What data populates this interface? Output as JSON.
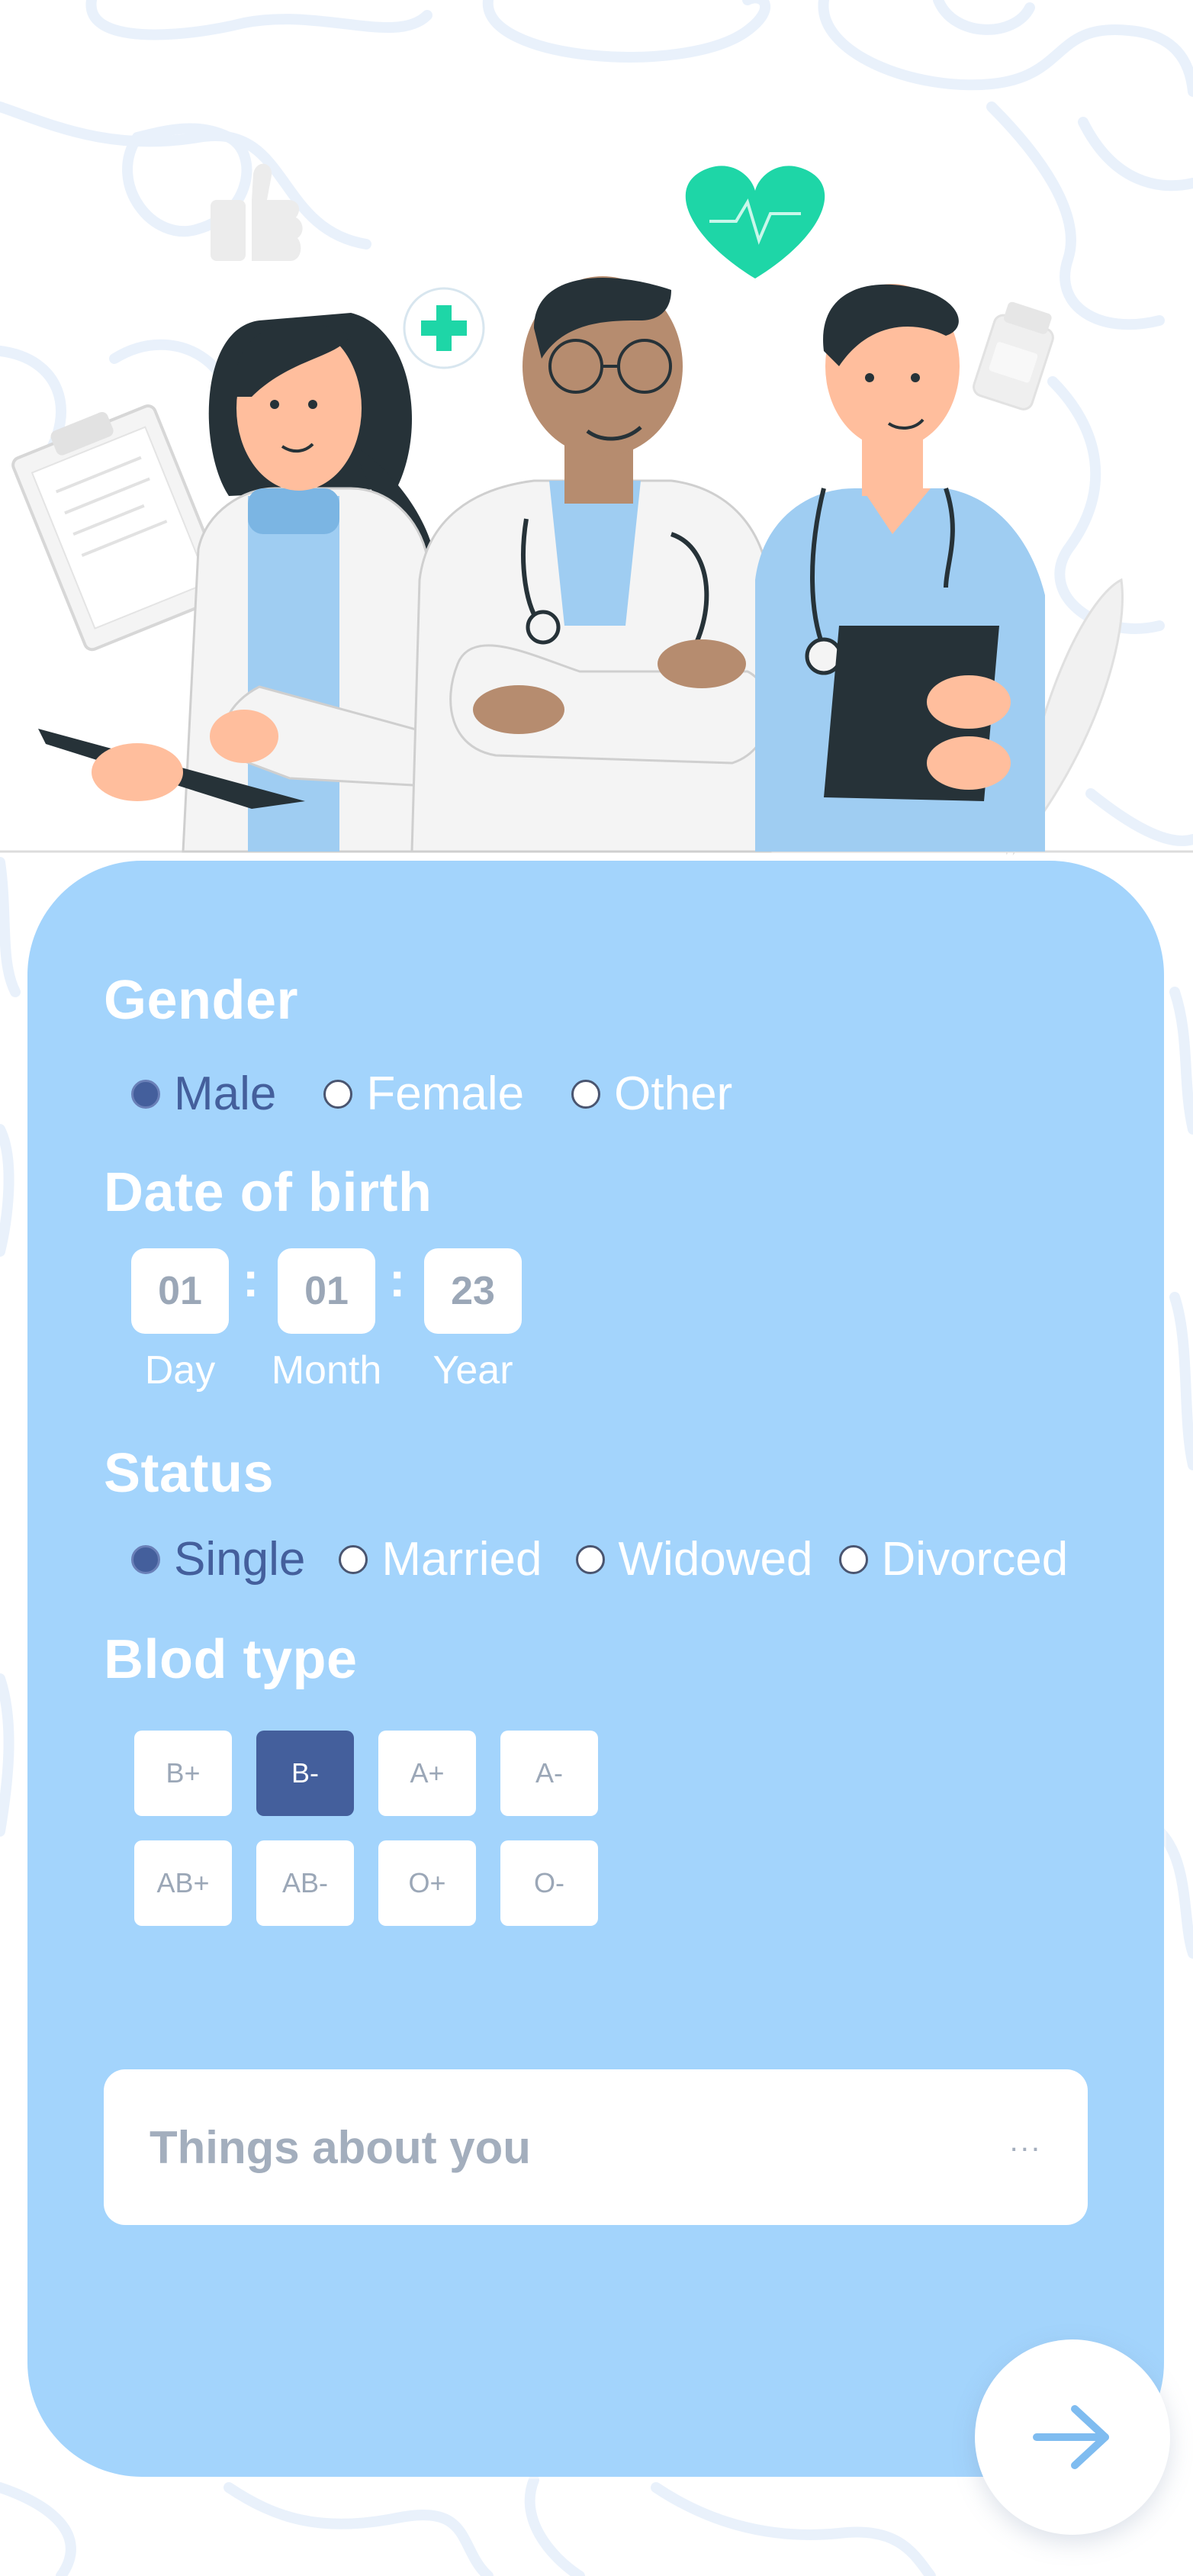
{
  "gender": {
    "title": "Gender",
    "options": [
      "Male",
      "Female",
      "Other"
    ],
    "selected": "Male"
  },
  "dob": {
    "title": "Date of birth",
    "day": "01",
    "month": "01",
    "year": "23",
    "separator": ":",
    "labels": {
      "day": "Day",
      "month": "Month",
      "year": "Year"
    }
  },
  "status": {
    "title": "Status",
    "options": [
      "Single",
      "Married",
      "Widowed",
      "Divorced"
    ],
    "selected": "Single"
  },
  "blood": {
    "title": "Blod type",
    "options": [
      "B+",
      "B-",
      "A+",
      "A-",
      "AB+",
      "AB-",
      "O+",
      "O-"
    ],
    "selected": "B-"
  },
  "about": {
    "placeholder": "Things about you",
    "more": "..."
  },
  "icons": {
    "next": "arrow-right-icon",
    "heart": "heart-pulse-icon",
    "plus": "medical-plus-icon",
    "like": "thumbs-up-icon",
    "pill": "pill-bottle-icon"
  },
  "colors": {
    "card": "#a3d4fc",
    "accent": "#445f9c",
    "text_muted": "#9ba7b7",
    "heart": "#1ed6a7",
    "arrow": "#7fbcf0"
  }
}
